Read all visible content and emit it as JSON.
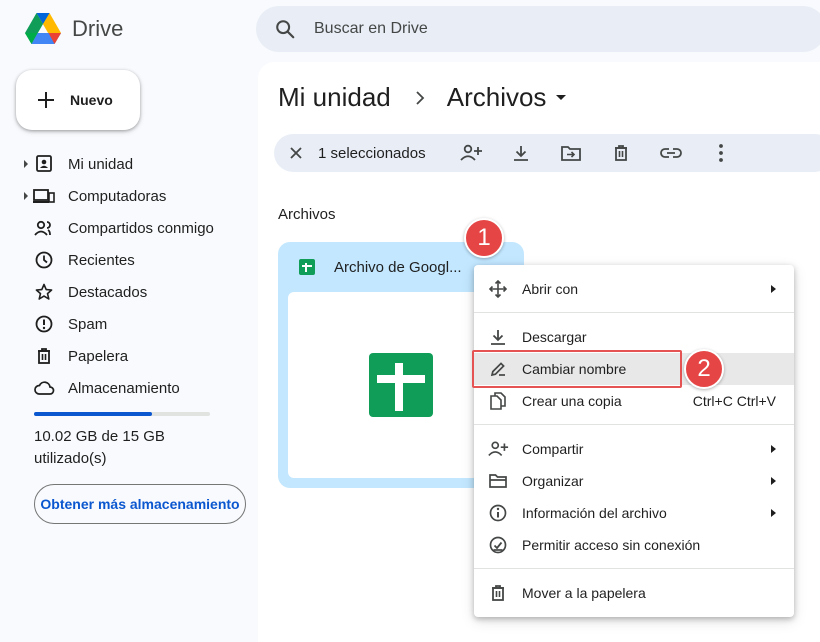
{
  "app": {
    "name": "Drive"
  },
  "search": {
    "placeholder": "Buscar en Drive"
  },
  "new_button": {
    "label": "Nuevo"
  },
  "sidebar": {
    "items": [
      {
        "label": "Mi unidad",
        "icon": "my-drive-icon",
        "expandable": true
      },
      {
        "label": "Computadoras",
        "icon": "computers-icon",
        "expandable": true
      },
      {
        "label": "Compartidos conmigo",
        "icon": "shared-icon",
        "expandable": false
      },
      {
        "label": "Recientes",
        "icon": "clock-icon",
        "expandable": false
      },
      {
        "label": "Destacados",
        "icon": "star-icon",
        "expandable": false
      },
      {
        "label": "Spam",
        "icon": "spam-icon",
        "expandable": false
      },
      {
        "label": "Papelera",
        "icon": "trash-icon",
        "expandable": false
      },
      {
        "label": "Almacenamiento",
        "icon": "cloud-icon",
        "expandable": false
      }
    ],
    "storage_used_fraction": 0.668,
    "storage_text": "10.02 GB de 15 GB utilizado(s)",
    "get_storage_label": "Obtener más almacenamiento"
  },
  "breadcrumb": {
    "parent": "Mi unidad",
    "current": "Archivos"
  },
  "selection_bar": {
    "count_label": "1 seleccionados",
    "tools": [
      "share-icon",
      "download-icon",
      "move-icon",
      "trash-icon",
      "link-icon",
      "more-icon"
    ]
  },
  "section_title": "Archivos",
  "file": {
    "name": "Archivo de Googl...",
    "type_icon": "sheets-icon"
  },
  "context_menu": {
    "groups": [
      [
        {
          "label": "Abrir con",
          "icon": "open-with-icon",
          "submenu": true
        }
      ],
      [
        {
          "label": "Descargar",
          "icon": "download-icon",
          "submenu": false
        },
        {
          "label": "Cambiar nombre",
          "icon": "rename-icon",
          "submenu": false,
          "highlighted": true
        },
        {
          "label": "Crear una copia",
          "icon": "copy-icon",
          "submenu": false,
          "shortcut": "Ctrl+C Ctrl+V"
        }
      ],
      [
        {
          "label": "Compartir",
          "icon": "share-icon",
          "submenu": true
        },
        {
          "label": "Organizar",
          "icon": "folder-icon",
          "submenu": true
        },
        {
          "label": "Información del archivo",
          "icon": "info-icon",
          "submenu": true
        },
        {
          "label": "Permitir acceso sin conexión",
          "icon": "offline-icon",
          "submenu": false
        }
      ],
      [
        {
          "label": "Mover a la papelera",
          "icon": "trash-icon",
          "submenu": false
        }
      ]
    ]
  },
  "annotations": {
    "step1": "1",
    "step2": "2",
    "color": "#e64545"
  }
}
